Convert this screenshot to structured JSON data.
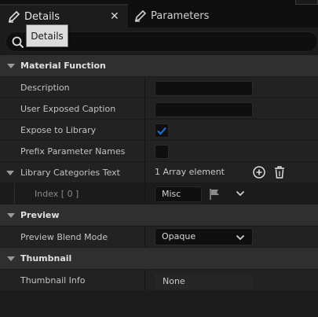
{
  "tabs": {
    "details_label": "Details",
    "parameters_label": "Parameters",
    "close_glyph": "✕"
  },
  "tooltip": {
    "text": "Details"
  },
  "search": {
    "placeholder": ""
  },
  "sections": {
    "material_function": {
      "title": "Material Function",
      "description_label": "Description",
      "caption_label": "User Exposed Caption",
      "expose_label": "Expose to Library",
      "expose_checked": true,
      "prefix_label": "Prefix Parameter Names",
      "prefix_checked": false,
      "library_label": "Library Categories Text",
      "array_count": "1 Array element",
      "index_label": "Index [ 0 ]",
      "index_value": "Misc"
    },
    "preview": {
      "title": "Preview",
      "blend_label": "Preview Blend Mode",
      "blend_value": "Opaque"
    },
    "thumbnail": {
      "title": "Thumbnail",
      "info_label": "Thumbnail Info",
      "info_value": "None"
    }
  },
  "colors": {
    "accent_check": "#1a6fd1",
    "background": "#1c1c1c",
    "category_bar": "#2f2f2f"
  },
  "icons": [
    "pencil-icon",
    "close-icon",
    "search-icon",
    "add-icon",
    "trash-icon",
    "flag-icon",
    "chevron-down-icon",
    "checkmark-icon"
  ]
}
